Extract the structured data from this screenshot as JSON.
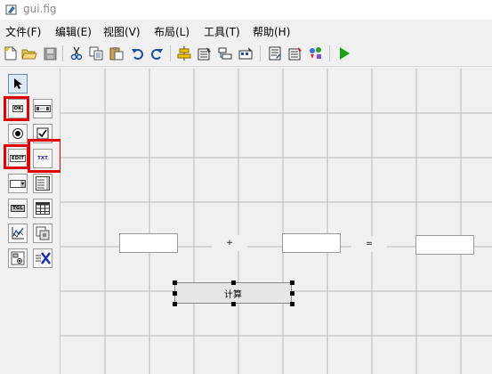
{
  "window": {
    "title": "gui.fig"
  },
  "menu": [
    "文件(F)",
    "编辑(E)",
    "视图(V)",
    "布局(L)",
    "工具(T)",
    "帮助(H)"
  ],
  "toolbar": {
    "icons": [
      "new-file-icon",
      "open-folder-icon",
      "save-icon",
      "cut-icon",
      "copy-icon",
      "paste-icon",
      "undo-icon",
      "redo-icon",
      "align-objects-icon",
      "menu-editor-icon",
      "tab-order-editor-icon",
      "toolbar-editor-icon",
      "m-file-editor-icon",
      "property-inspector-icon",
      "object-browser-icon",
      "run-figure-icon"
    ]
  },
  "palette": {
    "push_button": "OK",
    "edit_text": "EDIT",
    "static_text": "TXT",
    "toggle_button": "TGL"
  },
  "layout": {
    "operator_plus": "+",
    "operator_equals": "=",
    "button_label": "计算"
  },
  "colors": {
    "highlight": "#e00000",
    "run": "#1aa31a",
    "grid": "#b8b8b8"
  }
}
